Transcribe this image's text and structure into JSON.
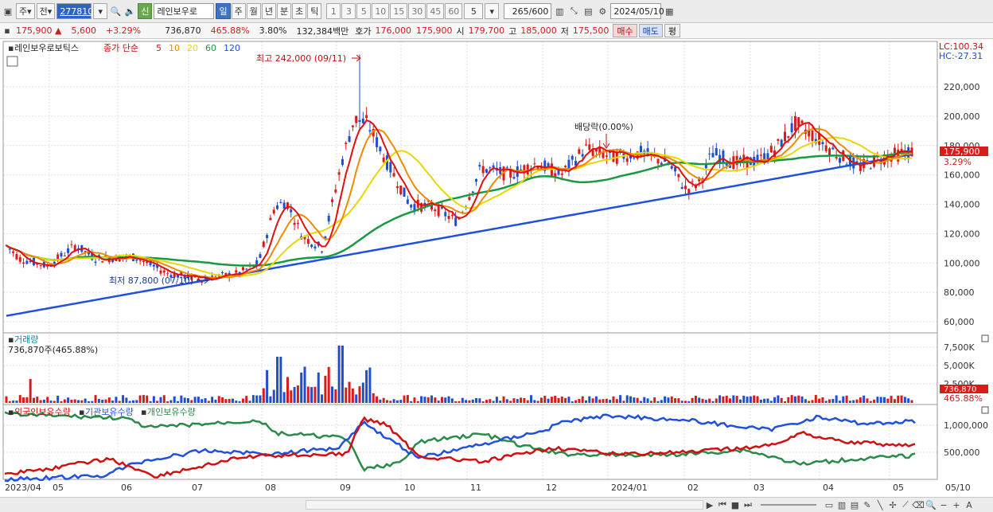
{
  "toolbar": {
    "market_type": "주",
    "market_sel": "전",
    "code": "277810",
    "badge": "신",
    "stock_name": "레인보우로",
    "periods": [
      "일",
      "주",
      "월",
      "년",
      "분",
      "초",
      "틱"
    ],
    "active_period": "일",
    "numbers": [
      "1",
      "3",
      "5",
      "10",
      "15",
      "30",
      "45",
      "60"
    ],
    "count_select": "5",
    "range": "265",
    "range_total": "/600",
    "date": "2024/05/10"
  },
  "quote": {
    "price": "175,900",
    "change": "5,600",
    "change_pct": "+3.29%",
    "volume": "736,870",
    "volume_ratio": "465.88%",
    "turnover_pct": "3.80%",
    "amount": "132,384백만",
    "ask_label": "호가",
    "ask1": "176,000",
    "ask2": "175,900",
    "open_label": "시",
    "open": "179,700",
    "high_label": "고",
    "high": "185,000",
    "low_label": "저",
    "low": "175,500",
    "buy": "매수",
    "sell": "매도",
    "eval": "평"
  },
  "price_panel": {
    "stock_label": "레인보우로보틱스",
    "indicator": "종가 단순",
    "ma_labels": [
      {
        "text": "5",
        "color": "#e01010"
      },
      {
        "text": "10",
        "color": "#f08a00"
      },
      {
        "text": "20",
        "color": "#e8d800"
      },
      {
        "text": "60",
        "color": "#1a9a40"
      },
      {
        "text": "120",
        "color": "#2050e0"
      }
    ],
    "high_annot": "최고 242,000 (09/11)",
    "low_annot": "최저 87,800 (07/10)",
    "dividend_annot": "배당락(0.00%)",
    "lc": "LC:100.34",
    "hc": "HC:-27.31",
    "price_tag": "175,900",
    "pct_tag": "3.29%",
    "y_ticks": [
      "220,000",
      "200,000",
      "180,000",
      "160,000",
      "140,000",
      "120,000",
      "100,000",
      "80,000",
      "60,000"
    ]
  },
  "volume_panel": {
    "title": "거래량",
    "value": "736,870주(465.88%)",
    "y_ticks": [
      "7,500K",
      "5,000K",
      "2,500K"
    ],
    "tag_value": "736,870",
    "tag_pct": "465.88%"
  },
  "holding_panel": {
    "legend": [
      {
        "text": "외국인보유수량",
        "color": "#d01010"
      },
      {
        "text": "기관보유수량",
        "color": "#2050e0"
      },
      {
        "text": "개인보유수량",
        "color": "#2a8a4a"
      }
    ],
    "y_ticks": [
      "1,000,000",
      "500,000"
    ]
  },
  "x_axis": [
    "2023/04",
    "05",
    "06",
    "07",
    "08",
    "09",
    "10",
    "11",
    "12",
    "2024/01",
    "02",
    "03",
    "04",
    "05"
  ],
  "x_axis_right": "05/10"
}
